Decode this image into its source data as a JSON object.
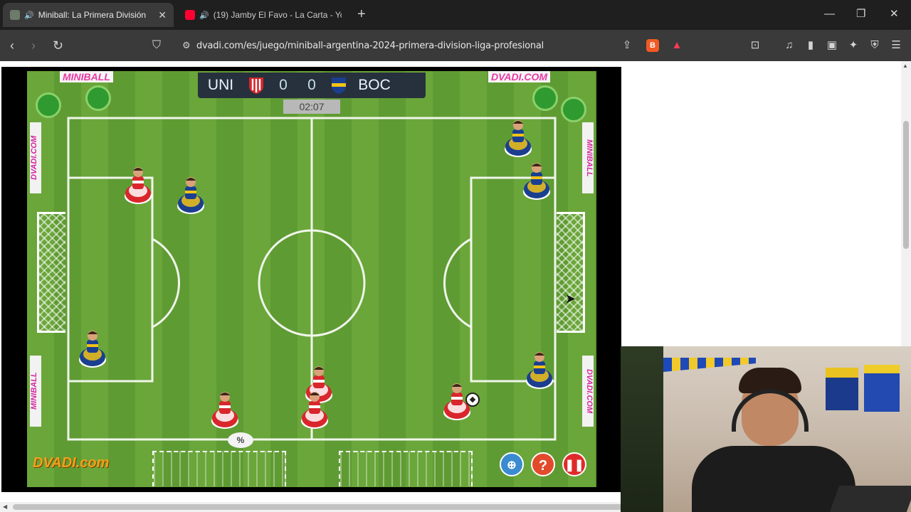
{
  "browser": {
    "tabs": [
      {
        "title": "Miniball: La Primera División",
        "active": true,
        "audio": true
      },
      {
        "title": "(19) Jamby El Favo - La Carta - Yo",
        "active": false,
        "audio": true
      }
    ],
    "url": "dvadi.com/es/juego/miniball-argentina-2024-primera-division-liga-profesional"
  },
  "game": {
    "home_team": "UNI",
    "away_team": "BOC",
    "home_score": "0",
    "away_score": "0",
    "timer": "02:07",
    "board_left": "MINIBALL",
    "board_right": "DVADI.COM",
    "side_ad_1": "DVADI.COM",
    "side_ad_2": "MINIBALL",
    "logo": "DVADI.com",
    "help_label": "?",
    "shot_indicator": "%",
    "colors": {
      "home": "#d9262c",
      "away": "#1b3f8f",
      "away_trim": "#f2c317",
      "pitch": "#6aa63a"
    }
  }
}
